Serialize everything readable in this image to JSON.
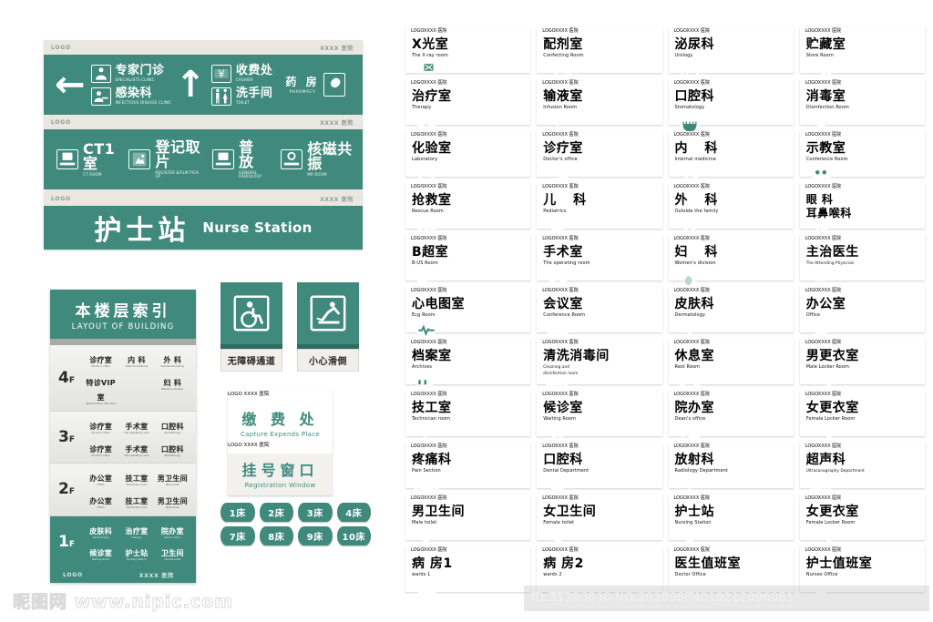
{
  "meta": {
    "logo_label": "LOGO",
    "hospital_label": "XXXX 医院",
    "accent_green": "#3f8a7d",
    "cap_gray": "#eae7e0"
  },
  "banner_directional": {
    "arrow_left": "←",
    "arrow_up": "↑",
    "left_group": [
      {
        "cn": "专家门诊",
        "en": "SPECIALISTS CLINIC",
        "icon": "specialist-icon"
      },
      {
        "cn": "感染科",
        "en": "INFECTIOUS DISEASE CLINIC",
        "icon": "infection-icon"
      }
    ],
    "up_group": [
      {
        "cn": "收费处",
        "en": "CASHIER",
        "icon": "cashier-icon"
      },
      {
        "cn": "洗手间",
        "en": "TOILET",
        "icon": "toilet-icon"
      }
    ],
    "pharmacy": {
      "cn": "药 房",
      "en": "PHARMACY",
      "icon": "pharmacy-icon"
    }
  },
  "banner_imaging": {
    "items": [
      {
        "cn": "CT1室",
        "en": "CT ROOM",
        "icon": "ct-scanner-icon"
      },
      {
        "cn": "登记取片",
        "en": "REGISTER &FILM PICK-UP",
        "icon": "film-icon"
      },
      {
        "cn": "普 放",
        "en": "GENERAL RADIOLOGY",
        "icon": "radiology-icon"
      },
      {
        "cn": "核磁共振",
        "en": "MR ROOM",
        "icon": "mri-icon"
      }
    ]
  },
  "banner_nurse": {
    "cn": "护士站",
    "en": "Nurse Station"
  },
  "floor_index": {
    "title_cn": "本楼层索引",
    "title_en": "LAYOUT OF BUILDING",
    "floors": [
      {
        "num": "4",
        "suffix": "F",
        "highlight": false,
        "lines": [
          [
            {
              "cn": "诊疗室",
              "en": "Doctor's office"
            },
            {
              "cn": "内 科",
              "en": "Internal medicine"
            },
            {
              "cn": "外 科",
              "en": "Outside the family"
            }
          ],
          [
            {
              "cn": "特诊VIP室",
              "en": "Special office VIP room"
            },
            {
              "cn": "",
              "en": ""
            },
            {
              "cn": "妇 科",
              "en": "Women's division"
            }
          ]
        ]
      },
      {
        "num": "3",
        "suffix": "F",
        "highlight": false,
        "lines": [
          [
            {
              "cn": "诊疗室",
              "en": "Doctor's office"
            },
            {
              "cn": "手术室",
              "en": "The operating room"
            },
            {
              "cn": "口腔科",
              "en": "Stomatology"
            }
          ],
          [
            {
              "cn": "诊疗室",
              "en": "Doctor's office"
            },
            {
              "cn": "手术室",
              "en": "The operating room"
            },
            {
              "cn": "口腔科",
              "en": "Stomatology"
            }
          ]
        ]
      },
      {
        "num": "2",
        "suffix": "F",
        "highlight": false,
        "lines": [
          [
            {
              "cn": "办公室",
              "en": "Office"
            },
            {
              "cn": "技工室",
              "en": "Technician room"
            },
            {
              "cn": "男卫生间",
              "en": "Male toilet"
            }
          ],
          [
            {
              "cn": "办公室",
              "en": "Office"
            },
            {
              "cn": "技工室",
              "en": "Technician room"
            },
            {
              "cn": "男卫生间",
              "en": "Male toilet"
            }
          ]
        ]
      },
      {
        "num": "1",
        "suffix": "F",
        "highlight": true,
        "lines": [
          [
            {
              "cn": "皮肤科",
              "en": "Dermatology"
            },
            {
              "cn": "治疗室",
              "en": "Therapy"
            },
            {
              "cn": "院办室",
              "en": "Dean's office"
            }
          ],
          [
            {
              "cn": "候诊室",
              "en": "Waiting Room"
            },
            {
              "cn": "护士站",
              "en": "Nursing Station"
            },
            {
              "cn": "卫生间",
              "en": "Female toilet"
            }
          ]
        ]
      }
    ]
  },
  "plates": [
    {
      "label": "无障碍通道",
      "icon": "wheelchair-icon"
    },
    {
      "label": "小心滑倒",
      "icon": "slippery-floor-icon"
    }
  ],
  "small_signs": [
    {
      "cn": "缴 费 处",
      "en": "Capture Expends Place",
      "name": "cashier-sign"
    },
    {
      "cn": "挂号窗口",
      "en": "Registration Window",
      "name": "registration-sign"
    }
  ],
  "bed_tags": [
    "1床",
    "2床",
    "3床",
    "4床",
    "7床",
    "8床",
    "9床",
    "10床"
  ],
  "department_cards": [
    {
      "cn": "X光室",
      "en": "The X-ray room",
      "icon": "xray-icon"
    },
    {
      "cn": "配剂室",
      "en": "Confecting Room",
      "icon": "pharmacy-mix-icon"
    },
    {
      "cn": "泌尿科",
      "en": "Urology",
      "icon": "bladder-icon"
    },
    {
      "cn": "贮藏室",
      "en": "Store Room",
      "icon": "storage-icon"
    },
    {
      "cn": "治疗室",
      "en": "Therapy",
      "icon": "therapy-icon"
    },
    {
      "cn": "输液室",
      "en": "Infusion Room",
      "icon": "iv-drip-icon"
    },
    {
      "cn": "口腔科",
      "en": "Stomatology",
      "icon": "mouth-icon"
    },
    {
      "cn": "消毒室",
      "en": "Disinfection Room",
      "icon": "sanitizer-icon"
    },
    {
      "cn": "化验室",
      "en": "Laboratory",
      "icon": "lab-beaker-icon"
    },
    {
      "cn": "诊疗室",
      "en": "Doctor's office",
      "icon": "consult-icon"
    },
    {
      "cn": "内 科",
      "en": "Internal medicine",
      "icon": "stethoscope-icon",
      "spaced": true
    },
    {
      "cn": "示教室",
      "en": "Conference Room",
      "icon": "classroom-icon"
    },
    {
      "cn": "抢救室",
      "en": "Rescue Room",
      "icon": "rescue-icon"
    },
    {
      "cn": "儿 科",
      "en": "Pediatrics",
      "icon": "baby-icon",
      "spaced": true
    },
    {
      "cn": "外 科",
      "en": "Outside the family",
      "icon": "surgery-walk-icon",
      "spaced": true
    },
    {
      "cn_lines": [
        "眼 科",
        "耳鼻喉科"
      ],
      "en": "",
      "icon": "ent-icon"
    },
    {
      "cn": "B超室",
      "en": "B-US Room",
      "icon": "ultrasound-icon"
    },
    {
      "cn": "手术室",
      "en": "The operating room",
      "icon": "operating-icon"
    },
    {
      "cn": "妇 科",
      "en": "Women's division",
      "icon": "pregnant-icon",
      "spaced": true
    },
    {
      "cn": "主治医生",
      "en": "The Attending Physician",
      "icon": "physician-icon"
    },
    {
      "cn": "心电图室",
      "en": "Ecg Room",
      "icon": "ecg-heart-icon"
    },
    {
      "cn": "会议室",
      "en": "Conference Room",
      "icon": "meeting-icon"
    },
    {
      "cn": "皮肤科",
      "en": "Dermatology",
      "icon": "skin-icon"
    },
    {
      "cn": "办公室",
      "en": "Office",
      "icon": "office-desk-icon"
    },
    {
      "cn": "档案室",
      "en": "Archives",
      "icon": "archive-binders-icon"
    },
    {
      "cn": "清洗消毒间",
      "en_lines": [
        "Cleaning and",
        "disinfection room"
      ],
      "icon": "cleaning-icon"
    },
    {
      "cn": "休息室",
      "en": "Rest Room",
      "icon": "lounge-icon"
    },
    {
      "cn": "男更衣室",
      "en": "Male Locker Room",
      "icon": "male-locker-icon"
    },
    {
      "cn": "技工室",
      "en": "Technician room",
      "icon": "microscope-icon"
    },
    {
      "cn": "候诊室",
      "en": "Waiting Room",
      "icon": "waiting-icon"
    },
    {
      "cn": "院办室",
      "en": "Dean's office",
      "icon": "dean-desk-icon"
    },
    {
      "cn": "女更衣室",
      "en": "Female Locker Room",
      "icon": "female-locker-icon"
    },
    {
      "cn": "疼痛科",
      "en": "Pain Section",
      "icon": "pain-icon"
    },
    {
      "cn": "口腔科",
      "en": "Dental Department",
      "icon": "tooth-icon"
    },
    {
      "cn": "放射科",
      "en": "Radiology Department",
      "icon": "radiology-table-icon"
    },
    {
      "cn": "超声科",
      "en": "Ultrasonography Department",
      "icon": "ultrasound-scan-icon"
    },
    {
      "cn": "男卫生间",
      "en": "Male toilet",
      "icon": "man-icon"
    },
    {
      "cn": "女卫生间",
      "en": "Female toilet",
      "icon": "woman-icon"
    },
    {
      "cn": "护士站",
      "en": "Nursing Station",
      "icon": "nurse-icon"
    },
    {
      "cn": "女更衣室",
      "en": "Female Locker Room",
      "icon": "female-locker-icon"
    },
    {
      "cn": "病 房1",
      "en": "wards 1",
      "icon": "patient-bed-icon"
    },
    {
      "cn": "病 房2",
      "en": "wards 2",
      "icon": "patient-bed-icon"
    },
    {
      "cn": "医生值班室",
      "en": "Doctor Office",
      "icon": "doctor-duty-icon"
    },
    {
      "cn": "护士值班室",
      "en": "Nurses Office",
      "icon": "nurse-duty-icon"
    }
  ],
  "watermarks": {
    "brand": "昵图网 www.nipic.com",
    "id_text": "ID:31390840 NO:20200604010212096081"
  }
}
